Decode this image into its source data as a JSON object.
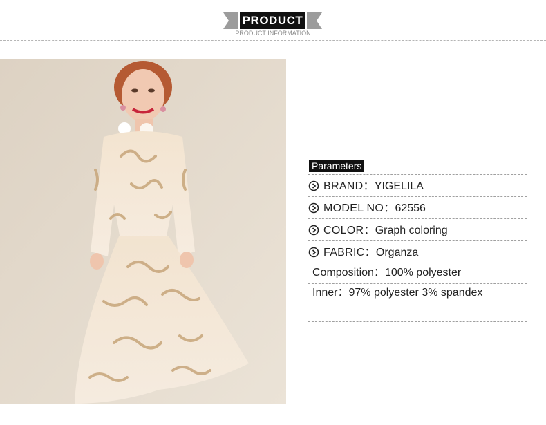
{
  "header": {
    "title": "PRODUCT",
    "subtitle": "PRODUCT INFORMATION"
  },
  "image": {
    "description_icon": "photo-of-model-in-lace-dress"
  },
  "parameters": {
    "title": "Parameters",
    "rows": [
      {
        "label": "BRAND：",
        "value": "YIGELILA",
        "icon": "circle-arrow-icon"
      },
      {
        "label": "MODEL NO：",
        "value": "62556",
        "icon": "circle-arrow-icon"
      },
      {
        "label": "COLOR：",
        "value": "Graph coloring",
        "icon": "circle-arrow-icon"
      },
      {
        "label": "FABRIC：",
        "value": "Organza",
        "icon": "circle-arrow-icon"
      }
    ],
    "composition": {
      "label": "Composition：",
      "value": "100% polyester"
    },
    "inner": {
      "label": "Inner：",
      "value": "97% polyester 3% spandex"
    }
  },
  "colors": {
    "accent": "#111111",
    "background": "#ffffff",
    "photo_bg": "#e4d9c9"
  }
}
